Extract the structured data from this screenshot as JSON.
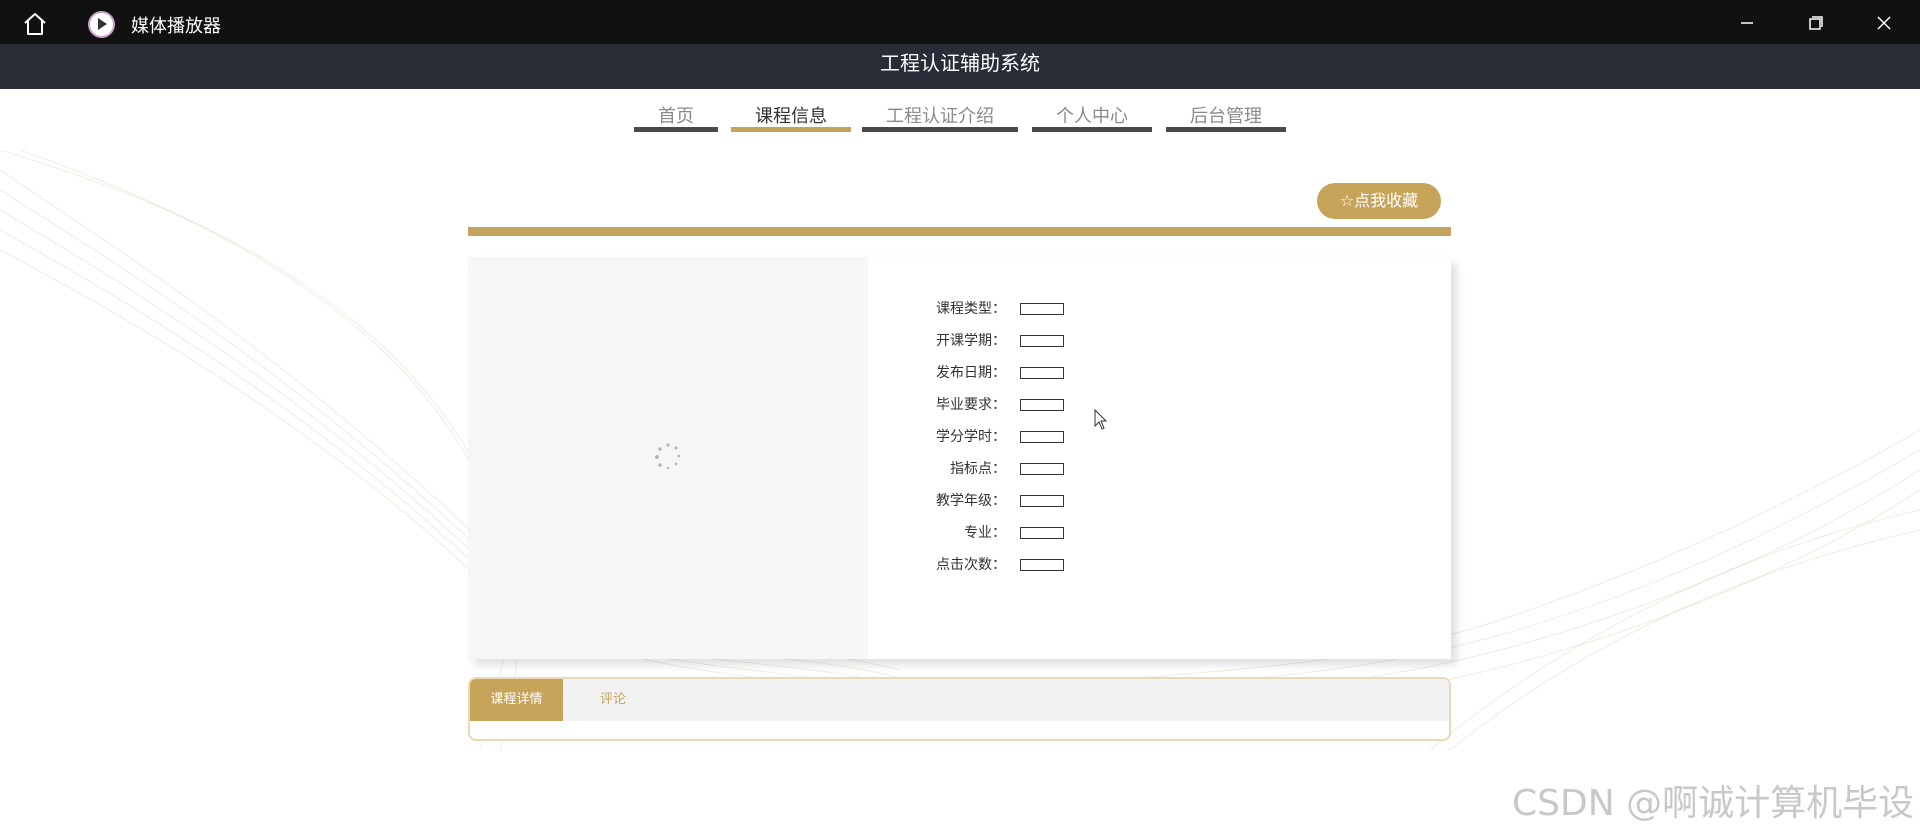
{
  "window": {
    "app_title": "媒体播放器",
    "icons": [
      "home-icon",
      "play-icon",
      "minimize-icon",
      "maximize-icon",
      "close-icon"
    ]
  },
  "site": {
    "title": "工程认证辅助系统"
  },
  "nav": {
    "items": [
      {
        "label": "首页",
        "active": false
      },
      {
        "label": "课程信息",
        "active": true
      },
      {
        "label": "工程认证介绍",
        "active": false
      },
      {
        "label": "个人中心",
        "active": false
      },
      {
        "label": "后台管理",
        "active": false
      }
    ]
  },
  "favorite": {
    "icon": "star-icon",
    "label": "点我收藏"
  },
  "course": {
    "fields": [
      {
        "label": "课程类型：",
        "value": ""
      },
      {
        "label": "开课学期：",
        "value": ""
      },
      {
        "label": "发布日期：",
        "value": ""
      },
      {
        "label": "毕业要求：",
        "value": ""
      },
      {
        "label": "学分学时：",
        "value": ""
      },
      {
        "label": "指标点：",
        "value": ""
      },
      {
        "label": "教学年级：",
        "value": ""
      },
      {
        "label": "专业：",
        "value": ""
      },
      {
        "label": "点击次数：",
        "value": ""
      }
    ]
  },
  "tabs": {
    "details": "课程详情",
    "comments": "评论"
  },
  "watermark": "CSDN @啊诚计算机毕设",
  "colors": {
    "accent": "#c6a55b",
    "header": "#282c36",
    "titlebar": "#111111"
  }
}
